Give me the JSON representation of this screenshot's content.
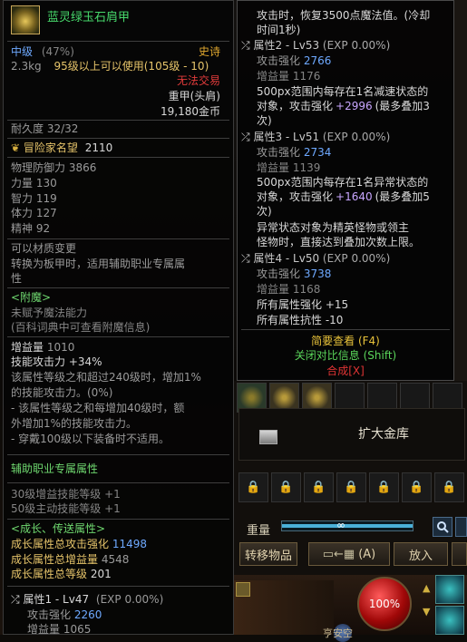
{
  "item": {
    "name": "蓝灵绿玉石肩甲",
    "grade": "中级",
    "grade_pct": "(47%)",
    "rarity": "史诗",
    "weight": "2.3kg",
    "level_req": "95级以上可以使用(105级 - 10)",
    "trade": "无法交易",
    "slot": "重甲(头肩)",
    "price": "19,180金币",
    "durability": "耐久度 32/32",
    "fame_label": "冒险家名望",
    "fame_value": "2110",
    "stats": [
      {
        "label": "物理防御力",
        "value": "3866"
      },
      {
        "label": "力量",
        "value": "130"
      },
      {
        "label": "智力",
        "value": "119"
      },
      {
        "label": "体力",
        "value": "127"
      },
      {
        "label": "精神",
        "value": "92"
      }
    ],
    "material_change": "可以材质变更",
    "transform_text_1": "转换为板甲时，适用辅助职业专属属",
    "transform_text_2": "性",
    "enchant_header": "<附魔>",
    "enchant_none": "未赋予魔法能力",
    "enchant_hint": "(百科词典中可查看附魔信息)",
    "buff_label": "增益量",
    "buff_value": "1010",
    "skill_atk_label": "技能攻击力",
    "skill_atk_value": "+34%",
    "desc_1": "该属性等级之和超过240级时，增加1%",
    "desc_2": "的技能攻击力。(0%)",
    "desc_3": "- 该属性等级之和每增加40级时，额",
    "desc_4": "外增加1%的技能攻击力。",
    "desc_5": "- 穿戴100级以下装备时不适用。",
    "support_header": "辅助职业专属属性",
    "support_1_label": "30级增益技能等级",
    "support_1_value": "+1",
    "support_2_label": "50级主动技能等级",
    "support_2_value": "+1",
    "growth_header": "<成长、传送属性>",
    "growth_1_label": "成长属性总攻击强化",
    "growth_1_value": "11498",
    "growth_2_label": "成长属性总增益量",
    "growth_2_value": "4548",
    "growth_3_label": "成长属性总等级",
    "growth_3_value": "201",
    "attr1_title": "属性1 - Lv47",
    "attr1_exp": "(EXP 0.00%)",
    "attr1_atk_label": "攻击强化",
    "attr1_atk_value": "2260",
    "attr1_buff_label": "增益量",
    "attr1_buff_value": "1065"
  },
  "compare": {
    "line_top_1": "攻击时，恢复3500点魔法值。(冷却",
    "line_top_2": "时间1秒)",
    "attr2_title": "属性2 - Lv53",
    "attr2_exp": "(EXP 0.00%)",
    "attr2_atk_label": "攻击强化",
    "attr2_atk_value": "2766",
    "attr2_buff_label": "增益量",
    "attr2_buff_value": "1176",
    "attr2_desc_1": "500px范围内每存在1名减速状态的",
    "attr2_desc_2a": "对象，攻击强化",
    "attr2_desc_2b": "+2996",
    "attr2_desc_2c": "(最多叠加3",
    "attr2_desc_3": "次)",
    "attr3_title": "属性3 - Lv51",
    "attr3_exp": "(EXP 0.00%)",
    "attr3_atk_label": "攻击强化",
    "attr3_atk_value": "2734",
    "attr3_buff_label": "增益量",
    "attr3_buff_value": "1139",
    "attr3_desc_1": "500px范围内每存在1名异常状态的",
    "attr3_desc_2a": "对象，攻击强化",
    "attr3_desc_2b": "+1640",
    "attr3_desc_2c": "(最多叠加5",
    "attr3_desc_3": "次)",
    "attr3_desc_4": "异常状态对象为精英怪物或领主",
    "attr3_desc_5": "怪物时，直接达到叠加次数上限。",
    "attr4_title": "属性4 - Lv50",
    "attr4_exp": "(EXP 0.00%)",
    "attr4_atk_label": "攻击强化",
    "attr4_atk_value": "3738",
    "attr4_buff_label": "增益量",
    "attr4_buff_value": "1168",
    "attr4_all_str_label": "所有属性强化",
    "attr4_all_str_value": "+15",
    "attr4_all_res_label": "所有属性抗性",
    "attr4_all_res_value": "-10",
    "link_brief": "简要查看 (F4)",
    "link_compare": "关闭对比信息 (Shift)",
    "link_synth": "合成[X]"
  },
  "inventory": {
    "expand_label": "扩大金库",
    "weight_label": "重量",
    "weight_value": "∞",
    "transfer_label": "转移物品",
    "sort_label": "(A)",
    "put_label": "放入",
    "hp_pct": "100%",
    "ui_sub_label": "亨安空"
  },
  "colors": {
    "item_name": "#47d86b",
    "epic": "#e0a82f",
    "gold": "#e6c46a",
    "green": "#6fd86f",
    "blue": "#6ea9ff",
    "red": "#e23b3b",
    "purple": "#c8a6ff"
  }
}
